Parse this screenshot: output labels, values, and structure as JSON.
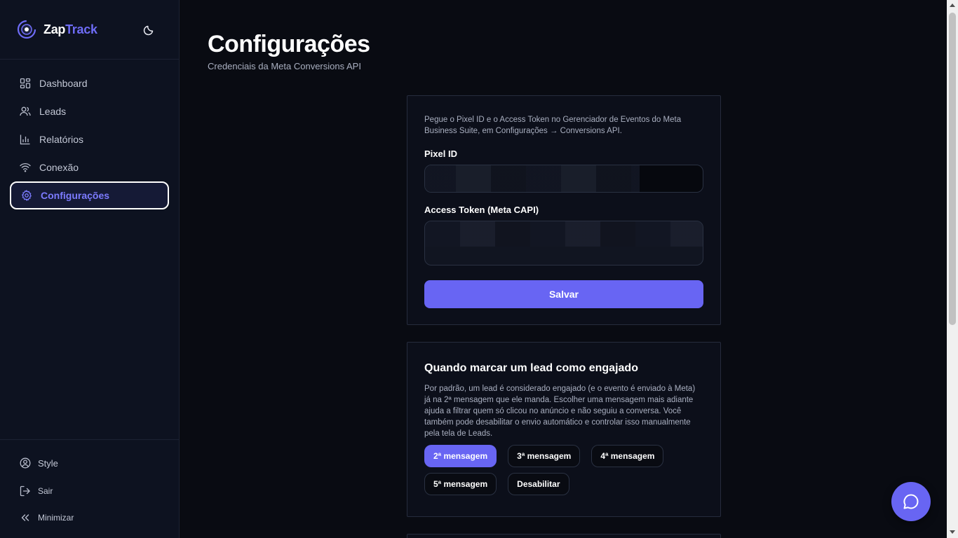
{
  "brand": {
    "name_part1": "Zap",
    "name_part2": "Track",
    "accent": "#6e6cf6"
  },
  "sidebar": {
    "items": [
      {
        "label": "Dashboard",
        "icon": "grid-icon"
      },
      {
        "label": "Leads",
        "icon": "users-icon"
      },
      {
        "label": "Relatórios",
        "icon": "bar-chart-icon"
      },
      {
        "label": "Conexão",
        "icon": "wifi-icon"
      },
      {
        "label": "Configurações",
        "icon": "gear-icon",
        "active": true
      }
    ],
    "bottom": [
      {
        "label": "Style",
        "icon": "user-circle-icon"
      },
      {
        "label": "Sair",
        "icon": "logout-icon"
      },
      {
        "label": "Minimizar",
        "icon": "chevrons-left-icon"
      }
    ]
  },
  "page": {
    "title": "Configurações",
    "subtitle": "Credenciais da Meta Conversions API"
  },
  "credentials": {
    "help": "Pegue o Pixel ID e o Access Token no Gerenciador de Eventos do Meta Business Suite, em Configurações → Conversions API.",
    "pixel_label": "Pixel ID",
    "token_label": "Access Token (Meta CAPI)",
    "save_label": "Salvar"
  },
  "engagement": {
    "title": "Quando marcar um lead como engajado",
    "description": "Por padrão, um lead é considerado engajado (e o evento é enviado à Meta) já na 2ª mensagem que ele manda. Escolher uma mensagem mais adiante ajuda a filtrar quem só clicou no anúncio e não seguiu a conversa. Você também pode desabilitar o envio automático e controlar isso manualmente pela tela de Leads.",
    "options": [
      "2ª mensagem",
      "3ª mensagem",
      "4ª mensagem",
      "5ª mensagem",
      "Desabilitar"
    ],
    "selected": "2ª mensagem"
  },
  "colors": {
    "primary": "#6865f3",
    "background": "#090b12",
    "sidebar": "#0d1220"
  }
}
